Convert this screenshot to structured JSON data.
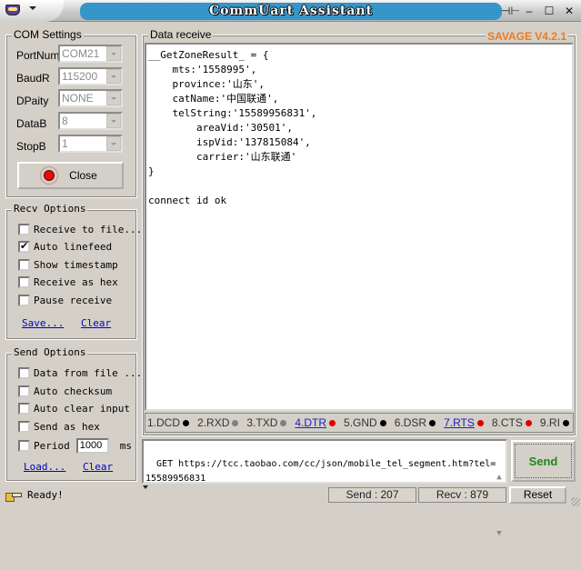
{
  "window": {
    "title": "CommUart Assistant",
    "controls": {
      "pin": "pin-icon",
      "minimize": "–",
      "maximize": "☐",
      "close": "✕"
    }
  },
  "com_settings": {
    "legend": "COM Settings",
    "fields": [
      {
        "label": "PortNum",
        "value": "COM21"
      },
      {
        "label": "BaudR",
        "value": "115200"
      },
      {
        "label": "DPaity",
        "value": "NONE"
      },
      {
        "label": "DataB",
        "value": "8"
      },
      {
        "label": "StopB",
        "value": "1"
      }
    ],
    "close_button": "Close",
    "port_status_color": "#ff0000"
  },
  "recv_options": {
    "legend": "Recv Options",
    "options": [
      {
        "label": "Receive to file...",
        "checked": false
      },
      {
        "label": "Auto linefeed",
        "checked": true
      },
      {
        "label": "Show timestamp",
        "checked": false
      },
      {
        "label": "Receive as hex",
        "checked": false
      },
      {
        "label": "Pause receive",
        "checked": false
      }
    ],
    "save_link": "Save...",
    "clear_link": "Clear"
  },
  "send_options": {
    "legend": "Send Options",
    "options": [
      {
        "label": "Data from file ...",
        "checked": false
      },
      {
        "label": "Auto checksum",
        "checked": false
      },
      {
        "label": "Auto clear input",
        "checked": false
      },
      {
        "label": "Send as hex",
        "checked": false
      }
    ],
    "period": {
      "label": "Period",
      "value": "1000",
      "unit": "ms",
      "checked": false
    },
    "load_link": "Load...",
    "clear_link": "Clear"
  },
  "receive": {
    "legend": "Data receive",
    "brand": "SAVAGE V4.2.1",
    "content": "__GetZoneResult_ = {\n    mts:'1558995',\n    province:'山东',\n    catName:'中国联通',\n    telString:'15589956831',\n        areaVid:'30501',\n        ispVid:'137815084',\n        carrier:'山东联通'\n}\n\nconnect id ok"
  },
  "pins": [
    {
      "label": "1.DCD",
      "color": "#000000",
      "link": false
    },
    {
      "label": "2.RXD",
      "color": "#808080",
      "link": false
    },
    {
      "label": "3.TXD",
      "color": "#808080",
      "link": false
    },
    {
      "label": "4.DTR",
      "color": "#e00000",
      "link": true
    },
    {
      "label": "5.GND",
      "color": "#000000",
      "link": false
    },
    {
      "label": "6.DSR",
      "color": "#000000",
      "link": false
    },
    {
      "label": "7.RTS",
      "color": "#e00000",
      "link": true
    },
    {
      "label": "8.CTS",
      "color": "#e00000",
      "link": false
    },
    {
      "label": "9.RI",
      "color": "#000000",
      "link": false
    }
  ],
  "send": {
    "input_value": "GET https://tcc.taobao.com/cc/json/mobile_tel_segment.htm?tel=\n15589956831",
    "send_button": "Send"
  },
  "status": {
    "text": "Ready!",
    "send_count": "Send : 207",
    "recv_count": "Recv : 879",
    "reset_button": "Reset"
  }
}
